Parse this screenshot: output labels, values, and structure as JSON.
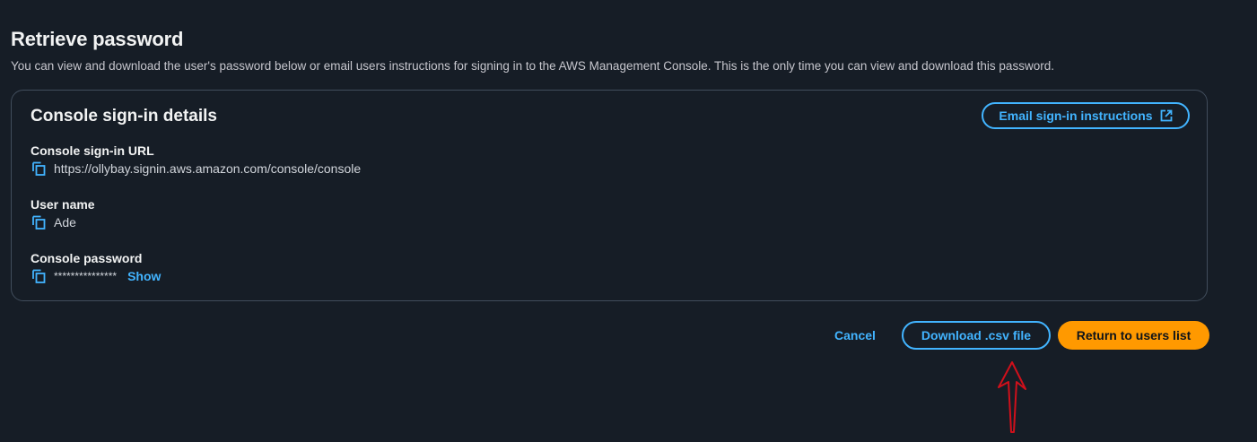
{
  "header": {
    "title": "Retrieve password",
    "description": "You can view and download the user's password below or email users instructions for signing in to the AWS Management Console. This is the only time you can view and download this password."
  },
  "panel": {
    "title": "Console sign-in details",
    "email_button_label": "Email sign-in instructions",
    "fields": [
      {
        "label": "Console sign-in URL",
        "value": "https://ollybay.signin.aws.amazon.com/console/console"
      },
      {
        "label": "User name",
        "value": "Ade"
      },
      {
        "label": "Console password",
        "value": "***************",
        "show_label": "Show"
      }
    ]
  },
  "actions": {
    "cancel_label": "Cancel",
    "download_label": "Download .csv file",
    "return_label": "Return to users list"
  },
  "colors": {
    "background": "#161d26",
    "link_blue": "#42b4ff",
    "primary_orange": "#ff9900",
    "panel_border": "#414d5c",
    "annotation_red": "#d0101b"
  },
  "icons": {
    "copy": "copy-icon",
    "external": "external-link-icon",
    "annotation": "red-arrow-annotation"
  }
}
